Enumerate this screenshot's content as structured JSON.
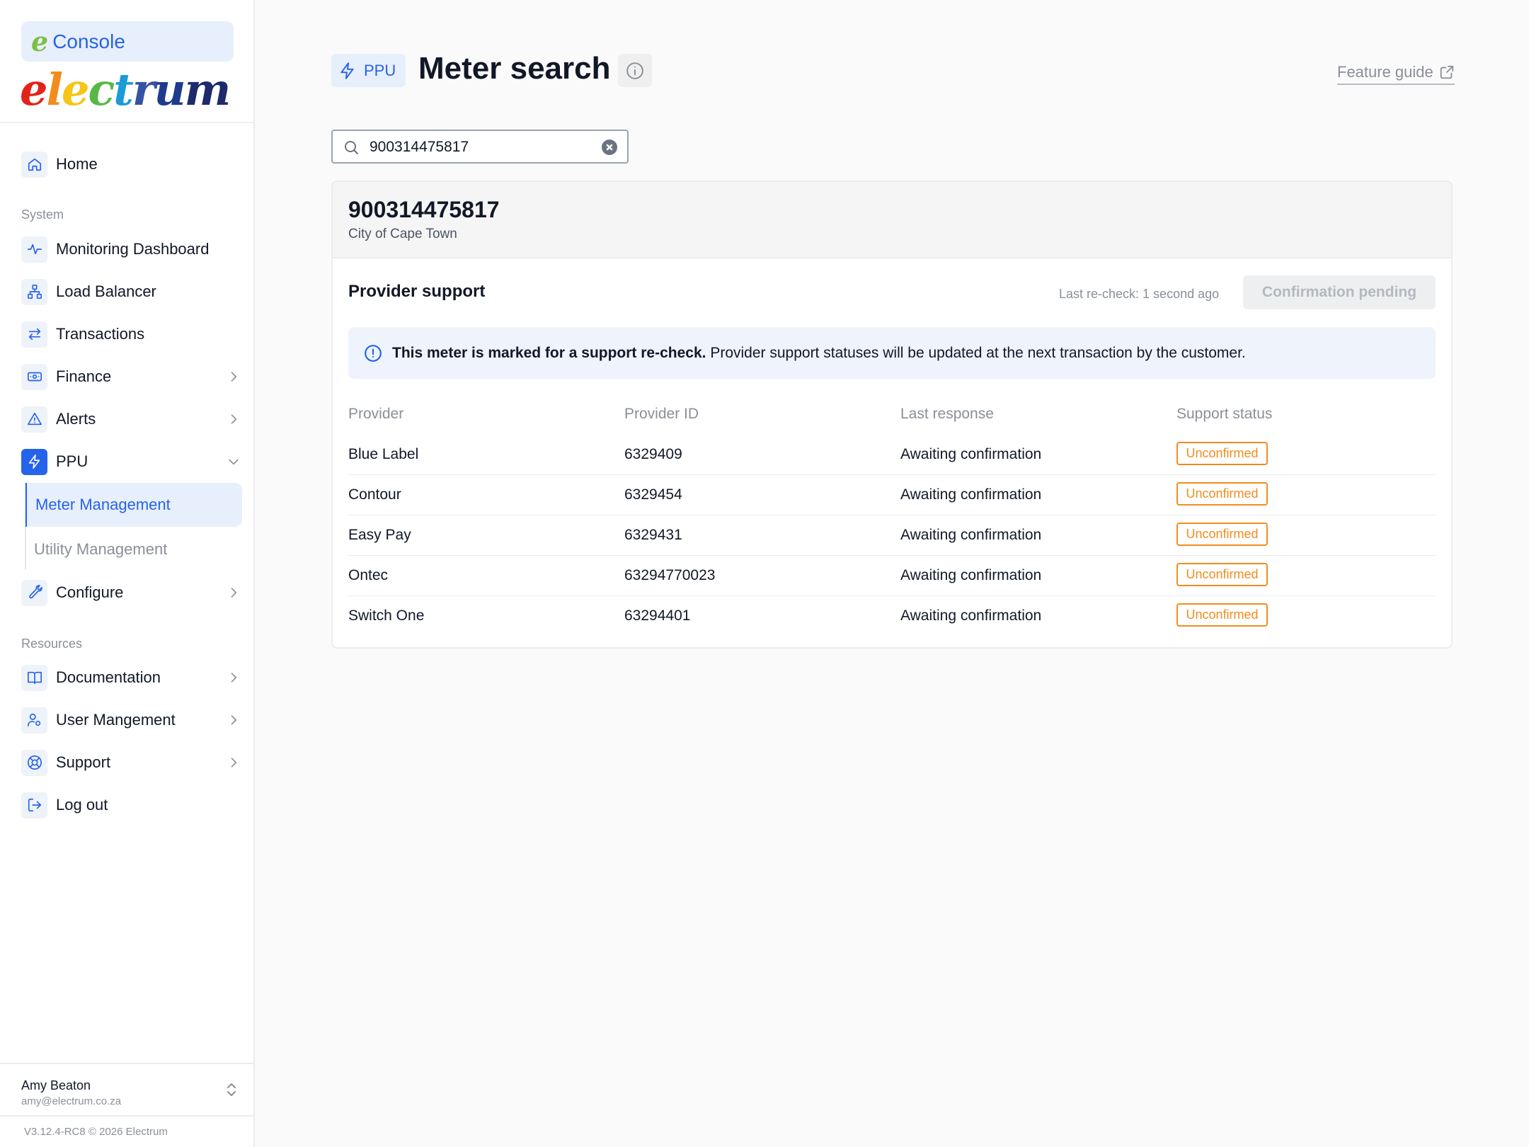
{
  "sidebar": {
    "console_label": "Console",
    "logo_text": "electrum",
    "home_label": "Home",
    "system_label": "System",
    "items": [
      {
        "label": "Monitoring Dashboard",
        "icon": "activity-icon"
      },
      {
        "label": "Load Balancer",
        "icon": "hierarchy-icon"
      },
      {
        "label": "Transactions",
        "icon": "arrows-exchange-icon"
      },
      {
        "label": "Finance",
        "icon": "banknote-icon"
      },
      {
        "label": "Alerts",
        "icon": "warning-triangle-icon"
      },
      {
        "label": "PPU",
        "icon": "lightning-icon"
      },
      {
        "label": "Configure",
        "icon": "wrench-icon"
      }
    ],
    "ppu_submenu": [
      "Meter Management",
      "Utility Management"
    ],
    "resources_label": "Resources",
    "resources": [
      {
        "label": "Documentation",
        "icon": "book-icon"
      },
      {
        "label": "User Mangement",
        "icon": "user-gear-icon"
      },
      {
        "label": "Support",
        "icon": "lifebuoy-icon"
      },
      {
        "label": "Log out",
        "icon": "logout-icon"
      }
    ],
    "user": {
      "name": "Amy Beaton",
      "email": "amy@electrum.co.za"
    },
    "version": "V3.12.4-RC8 © 2026 Electrum"
  },
  "header": {
    "badge": "PPU",
    "title": "Meter search",
    "feature_guide": "Feature guide"
  },
  "search": {
    "value": "900314475817"
  },
  "meter": {
    "number": "900314475817",
    "city": "City of Cape Town"
  },
  "provider_support": {
    "title": "Provider support",
    "last_recheck": "Last re-check: 1 second ago",
    "button": "Confirmation pending",
    "notice_bold": "This meter is marked for a support re-check.",
    "notice_rest": " Provider support statuses will be updated at the next transaction by the customer."
  },
  "table": {
    "headers": [
      "Provider",
      "Provider ID",
      "Last response",
      "Support status"
    ],
    "rows": [
      [
        "Blue Label",
        "6329409",
        "Awaiting confirmation",
        "Unconfirmed"
      ],
      [
        "Contour",
        "6329454",
        "Awaiting confirmation",
        "Unconfirmed"
      ],
      [
        "Easy Pay",
        "6329431",
        "Awaiting confirmation",
        "Unconfirmed"
      ],
      [
        "Ontec",
        "63294770023",
        "Awaiting confirmation",
        "Unconfirmed"
      ],
      [
        "Switch One",
        "63294401",
        "Awaiting confirmation",
        "Unconfirmed"
      ]
    ]
  },
  "colors": {
    "accent": "#2563eb",
    "warning": "#f28c1e"
  }
}
